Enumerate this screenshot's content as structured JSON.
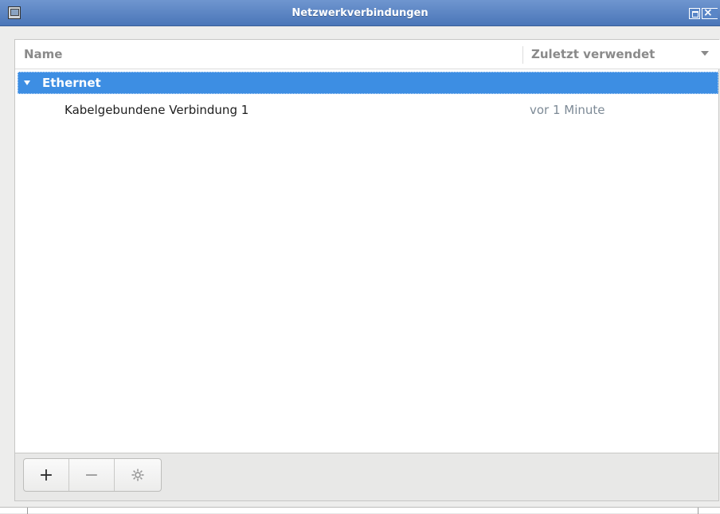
{
  "window": {
    "title": "Netzwerkverbindungen"
  },
  "list": {
    "columns": {
      "name": "Name",
      "last_used": "Zuletzt verwendet"
    },
    "groups": [
      {
        "label": "Ethernet",
        "expanded": true,
        "selected": true,
        "connections": [
          {
            "name": "Kabelgebundene Verbindung 1",
            "last_used": "vor 1 Minute"
          }
        ]
      }
    ]
  },
  "toolbar": {
    "add_label": "+",
    "remove_label": "−",
    "settings_icon": "gear-icon"
  },
  "colors": {
    "titlebar": "#4a76b8",
    "selection": "#3d8ee3",
    "muted_text": "#7d8a96"
  }
}
